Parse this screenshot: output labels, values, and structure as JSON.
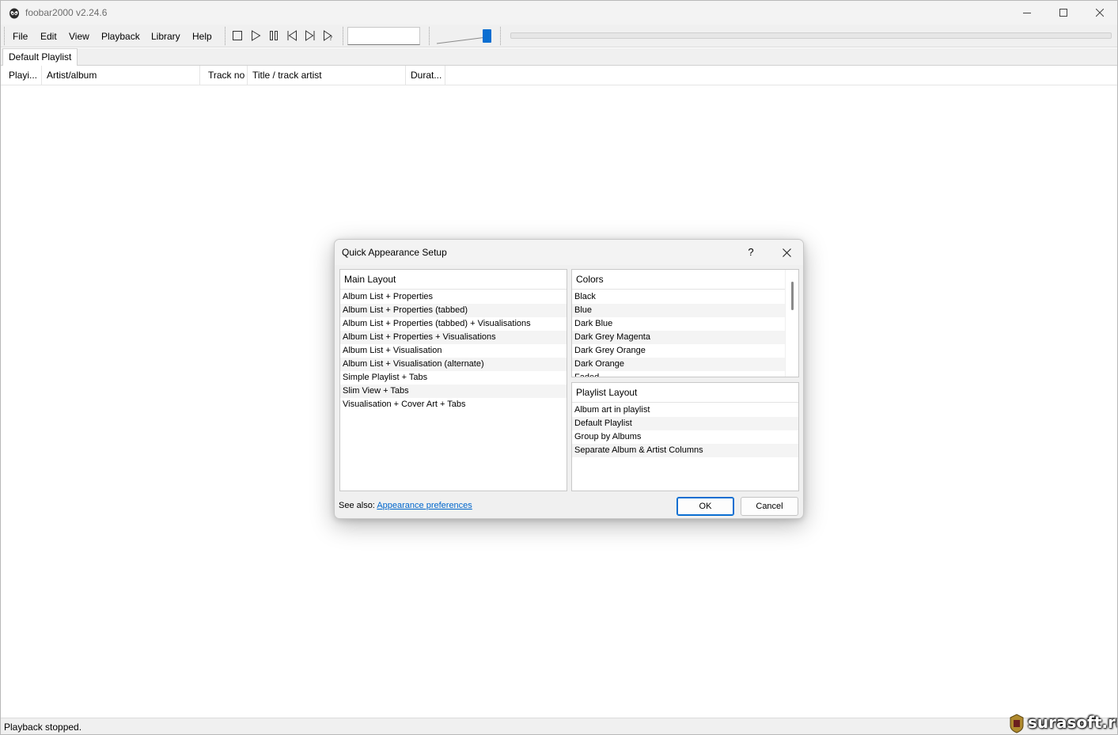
{
  "window": {
    "title": "foobar2000 v2.24.6"
  },
  "menu": {
    "items": [
      "File",
      "Edit",
      "View",
      "Playback",
      "Library",
      "Help"
    ]
  },
  "toolbar": {
    "buttons": [
      "stop-icon",
      "play-icon",
      "pause-icon",
      "previous-icon",
      "next-icon",
      "random-icon"
    ],
    "volume_level": 0.92
  },
  "playlist": {
    "tabs": [
      "Default Playlist"
    ],
    "columns": [
      "Playi...",
      "Artist/album",
      "Track no",
      "Title / track artist",
      "Durat..."
    ]
  },
  "status": {
    "text": "Playback stopped."
  },
  "watermark": {
    "text": "surasoft.ru"
  },
  "dialog": {
    "title": "Quick Appearance Setup",
    "help_label": "?",
    "main_layout": {
      "header": "Main Layout",
      "items": [
        "Album List + Properties",
        "Album List + Properties (tabbed)",
        "Album List + Properties (tabbed) + Visualisations",
        "Album List + Properties + Visualisations",
        "Album List + Visualisation",
        "Album List + Visualisation (alternate)",
        "Simple Playlist + Tabs",
        "Slim View + Tabs",
        "Visualisation + Cover Art + Tabs"
      ]
    },
    "colors": {
      "header": "Colors",
      "items": [
        "Black",
        "Blue",
        "Dark Blue",
        "Dark Grey Magenta",
        "Dark Grey Orange",
        "Dark Orange",
        "Faded"
      ]
    },
    "playlist_layout": {
      "header": "Playlist Layout",
      "items": [
        "Album art in playlist",
        "Default Playlist",
        "Group by Albums",
        "Separate Album & Artist Columns"
      ]
    },
    "see_also_label": "See also:",
    "see_also_link": "Appearance preferences",
    "ok_label": "OK",
    "cancel_label": "Cancel"
  }
}
